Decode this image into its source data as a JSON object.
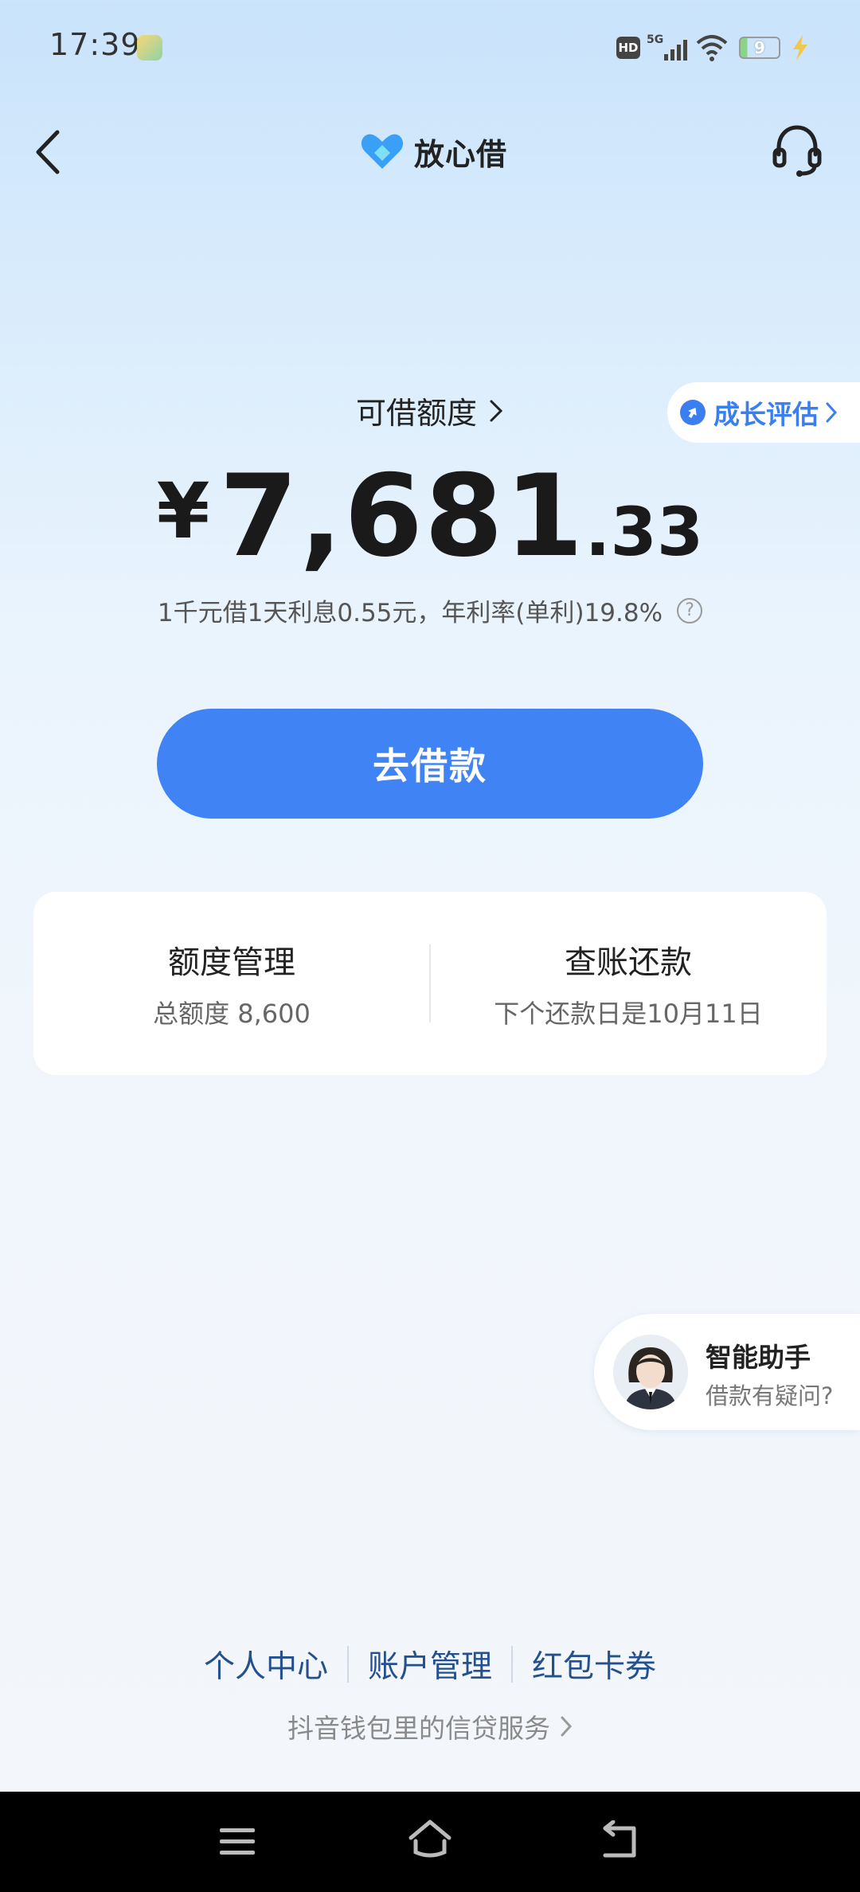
{
  "status_bar": {
    "time": "17:39",
    "hd_label": "HD",
    "network": "5G",
    "battery_level": "9",
    "icons": [
      "app-notification-icon",
      "hd-icon",
      "signal-5g-icon",
      "wifi-icon",
      "battery-icon",
      "charging-bolt-icon"
    ]
  },
  "header": {
    "title": "放心借",
    "icons": [
      "back-arrow-icon",
      "heart-logo-icon",
      "headset-icon"
    ]
  },
  "limit": {
    "label": "可借额度",
    "currency": "¥",
    "amount_integer": "7,681",
    "amount_decimal": ".33",
    "rate_text": "1千元借1天利息0.55元，年利率(单利)19.8%",
    "help_glyph": "?",
    "growth_label": "成长评估"
  },
  "actions": {
    "borrow_button": "去借款"
  },
  "card": {
    "left_title": "额度管理",
    "left_sub": "总额度 8,600",
    "right_title": "查账还款",
    "right_sub": "下个还款日是10月11日"
  },
  "assistant": {
    "title": "智能助手",
    "subtitle": "借款有疑问?"
  },
  "bottom": {
    "links": [
      "个人中心",
      "账户管理",
      "红包卡券"
    ],
    "service_text": "抖音钱包里的信贷服务"
  },
  "colors": {
    "accent": "#3f83f5",
    "link": "#24508f",
    "badge_text": "#3a7ef0"
  }
}
